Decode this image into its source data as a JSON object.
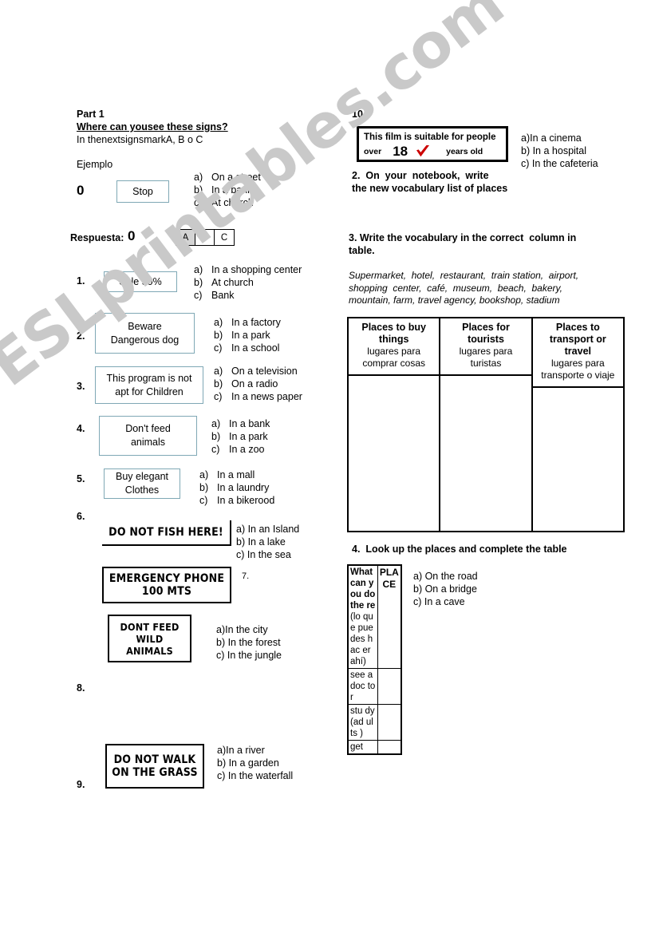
{
  "watermark": "ESLprintables.com",
  "left": {
    "part_title": "Part 1",
    "instruction_main": "Where can yousee these signs?",
    "instruction_sub": "In thenextsignsmarkA, B o C",
    "example_label": "Ejemplo",
    "example_number": "0",
    "example_sign": "Stop",
    "example_options": [
      {
        "letter": "a)",
        "text": "On a street"
      },
      {
        "letter": "b)",
        "text": "In a bank"
      },
      {
        "letter": "c)",
        "text": "At church"
      }
    ],
    "answer_label": "Respuesta:",
    "answer_number": "0",
    "answer_choices": [
      "A",
      "B",
      "C"
    ],
    "answer_selected": "A",
    "questions": [
      {
        "number": "1.",
        "sign_lines": [
          "Sale 50%"
        ],
        "options": [
          {
            "letter": "a)",
            "text": "In a shopping center"
          },
          {
            "letter": "b)",
            "text": "At church"
          },
          {
            "letter": "c)",
            "text": "Bank"
          }
        ]
      },
      {
        "number": "2.",
        "sign_lines": [
          "Beware",
          "Dangerous dog"
        ],
        "options": [
          {
            "letter": "a)",
            "text": "In a factory"
          },
          {
            "letter": "b)",
            "text": "In a park"
          },
          {
            "letter": "c)",
            "text": "In a school"
          }
        ]
      },
      {
        "number": "3.",
        "sign_lines": [
          "This program is not",
          "apt for Children"
        ],
        "options": [
          {
            "letter": "a)",
            "text": "On a television"
          },
          {
            "letter": "b)",
            "text": "On a radio"
          },
          {
            "letter": "c)",
            "text": "In a news paper"
          }
        ]
      },
      {
        "number": "4.",
        "sign_lines": [
          "Don't feed",
          "animals"
        ],
        "options": [
          {
            "letter": "a)",
            "text": "In a bank"
          },
          {
            "letter": "b)",
            "text": "In a park"
          },
          {
            "letter": "c)",
            "text": "In a zoo"
          }
        ]
      },
      {
        "number": "5.",
        "sign_lines": [
          "Buy elegant",
          "Clothes"
        ],
        "options": [
          {
            "letter": "a)",
            "text": "In a mall"
          },
          {
            "letter": "b)",
            "text": "In a laundry"
          },
          {
            "letter": "c)",
            "text": "In a bikerood"
          }
        ]
      }
    ],
    "q6_number": "6.",
    "q6_sign": "DO NOT FISH HERE!",
    "q6_options": [
      "a) In an Island",
      "b) In a lake",
      "c) In the sea"
    ],
    "q7_number": "7.",
    "q7_sign_lines": [
      "EMERGENCY PHONE",
      "100 MTS"
    ],
    "q7b_sign_lines": [
      "DONT FEED",
      "WILD",
      "ANIMALS"
    ],
    "q7b_options": [
      "a)In the city",
      "b) In the forest",
      "c) In the jungle"
    ],
    "q8_number": "8.",
    "q9_number": "9.",
    "q9_sign_lines": [
      "DO NOT WALK",
      "ON THE GRASS"
    ],
    "q9_options": [
      "a)In a river",
      "b) In a garden",
      "c) In the waterfall"
    ]
  },
  "right": {
    "q10_number": "10.",
    "film_sign": {
      "line1": "This film is suitable for people",
      "over": "over",
      "age": "18",
      "check_color": "#cc0000",
      "years": "years old"
    },
    "q10_options": [
      "a)In a cinema",
      "b) In a hospital",
      "c) In the cafeteria"
    ],
    "task2": "2.  On  your  notebook,  write\nthe new vocabulary list of places",
    "task3_title": "3. Write the vocabulary in the correct  column in\ntable.",
    "task3_words": "Supermarket,  hotel,  restaurant,  train station,  airport,\nshopping  center,  café,  museum,  beach,  bakery,\nmountain, farm, travel agency, bookshop, stadium",
    "vocab_columns": [
      {
        "en": "Places to buy\nthings",
        "es": "lugares para\ncomprar cosas",
        "cells": [
          ""
        ]
      },
      {
        "en": "Places for\ntourists",
        "es": "lugares para\nturistas",
        "cells": [
          ""
        ]
      },
      {
        "en": "Places to\ntransport or\ntravel",
        "es": "lugares para\ntransporte o\nviaje",
        "cells": [
          ""
        ]
      }
    ],
    "task4_title": "4.  Look up the places and complete the table",
    "places_table": {
      "header_col1_bold": "What can you do the re",
      "header_col1_sub": "(lo que pue des hac er ahí)",
      "header_col2": "PLACE",
      "rows": [
        {
          "activity": "see a doc tor",
          "place": ""
        },
        {
          "activity": "stu dy (ad ults )",
          "place": ""
        },
        {
          "activity": "get",
          "place": ""
        }
      ]
    },
    "q_options_right": [
      "a) On the road",
      "b) On a bridge",
      "c) In a cave"
    ]
  }
}
